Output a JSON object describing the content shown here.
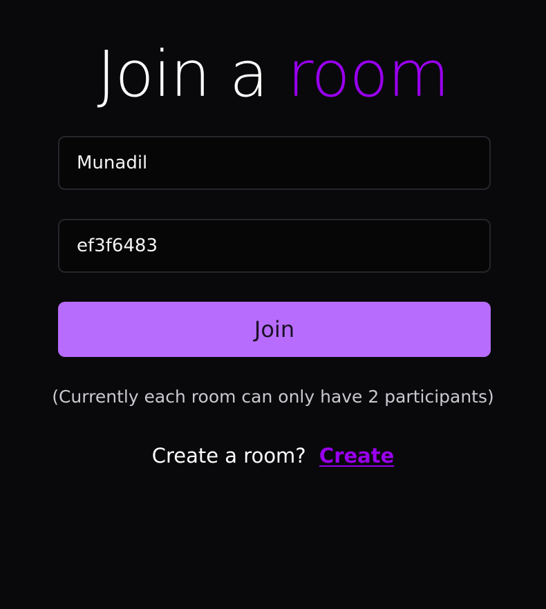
{
  "heading": {
    "prefix": "Join a ",
    "accent": "room"
  },
  "form": {
    "name_value": "Munadil",
    "room_value": "ef3f6483",
    "join_label": "Join"
  },
  "note": "(Currently each room can only have 2 participants)",
  "create": {
    "prompt": "Create a room?",
    "link_label": "Create"
  },
  "colors": {
    "background": "#09090b",
    "accent": "#9900ee",
    "button": "#b86cfd"
  }
}
